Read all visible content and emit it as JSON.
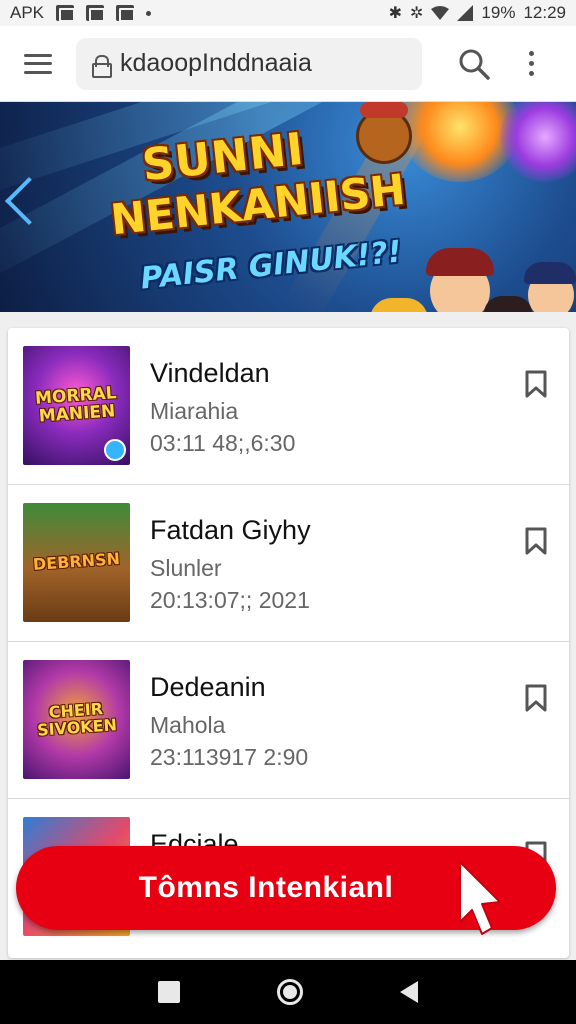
{
  "status_bar": {
    "left_label": "APK",
    "battery": "19%",
    "time": "12:29"
  },
  "browser": {
    "url": "kdaoopInddnaaia"
  },
  "banner": {
    "line1": "SUNNI",
    "line2": "NENKANIISH",
    "line3": "PAISR GINUK!?!"
  },
  "items": [
    {
      "title": "Vindeldan",
      "subtitle": "Miarahia",
      "date": "03:11 48;,6:30",
      "thumb_text": "MORRAL MANIEN",
      "thumb_icon": "gamepad-icon"
    },
    {
      "title": "Fatdan Giyhy",
      "subtitle": "Slunler",
      "date": "20:13:07;; 2021",
      "thumb_text": "DEBRNSN",
      "thumb_icon": "none"
    },
    {
      "title": "Dedeanin",
      "subtitle": "Mahola",
      "date": "23:113917 2:90",
      "thumb_text": "CHEIR SIVOKEN",
      "thumb_icon": "none"
    },
    {
      "title": "Edciale",
      "subtitle": "",
      "date": "",
      "thumb_text": "",
      "thumb_icon": "none"
    }
  ],
  "cta": {
    "label": "Tômns Intenkianl"
  },
  "colors": {
    "cta": "#e60012",
    "banner_title": "#ffd42a",
    "banner_sub": "#6ad8ff"
  }
}
